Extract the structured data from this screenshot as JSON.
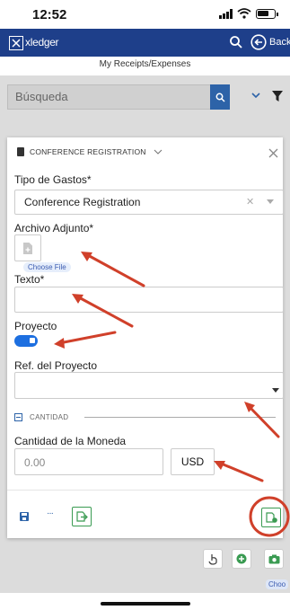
{
  "status": {
    "time": "12:52"
  },
  "header": {
    "logo_text": "xledger",
    "back_label": "Back"
  },
  "page": {
    "title": "My Receipts/Expenses"
  },
  "search": {
    "placeholder": "Búsqueda"
  },
  "modal": {
    "title": "CONFERENCE REGISTRATION",
    "expense_type_label": "Tipo de Gastos*",
    "expense_type_value": "Conference Registration",
    "attachment_label": "Archivo Adjunto*",
    "choose_file_label": "Choose File",
    "text_label": "Texto*",
    "text_value": "",
    "project_label": "Proyecto",
    "project_toggle": true,
    "project_ref_label": "Ref. del Proyecto",
    "project_ref_value": "",
    "section_label": "CANTIDAD",
    "amount_label": "Cantidad de la Moneda",
    "amount_value": "0.00",
    "currency_value": "USD",
    "more_label": "···"
  },
  "toolbar": {
    "choose_label": "Choo"
  },
  "annotations": {
    "color": "#d0402a",
    "arrow_count": 6
  },
  "colors": {
    "header": "#1e3f8a",
    "accent": "#2d63a8",
    "toggle": "#1d6fe0",
    "success": "#3a9b52"
  }
}
